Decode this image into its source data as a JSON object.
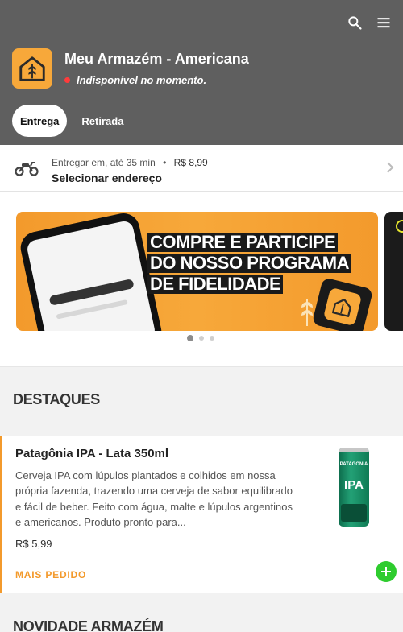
{
  "store": {
    "name": "Meu Armazém - Americana",
    "status": "Indisponível no momento.",
    "status_color": "#ff3b3b",
    "logo_icon": "house-wheat-logo"
  },
  "header": {
    "background": "#5f5f5f",
    "search_icon": "search-icon",
    "menu_icon": "hamburger-menu-icon"
  },
  "tabs": [
    {
      "label": "Entrega",
      "active": true
    },
    {
      "label": "Retirada",
      "active": false
    }
  ],
  "delivery": {
    "icon": "motorcycle-icon",
    "prefix": "Entregar em,",
    "time": "até 35 min",
    "separator": "•",
    "fee": "R$ 8,99",
    "address_cta": "Selecionar endereço"
  },
  "banner": {
    "title_lines": [
      "COMPRE E PARTICIPE",
      "DO NOSSO PROGRAMA",
      "DE FIDELIDADE"
    ],
    "accent_color": "#f39a2c",
    "pager": {
      "count": 3,
      "active_index": 0
    }
  },
  "sections": {
    "highlights": "DESTAQUES",
    "new": "NOVIDADE ARMAZÉM"
  },
  "product": {
    "name": "Patagônia IPA - Lata 350ml",
    "description": "Cerveja IPA com lúpulos plantados e colhidos em nossa própria fazenda, trazendo uma cerveja de sabor equilibrado e fácil de beber. Feito com água, malte e lúpulos argentinos e americanos. Produto pronto para...",
    "price": "R$ 5,99",
    "tag": "MAIS PEDIDO",
    "tag_color": "#f39a2c",
    "add_color": "#2ecc2e"
  }
}
